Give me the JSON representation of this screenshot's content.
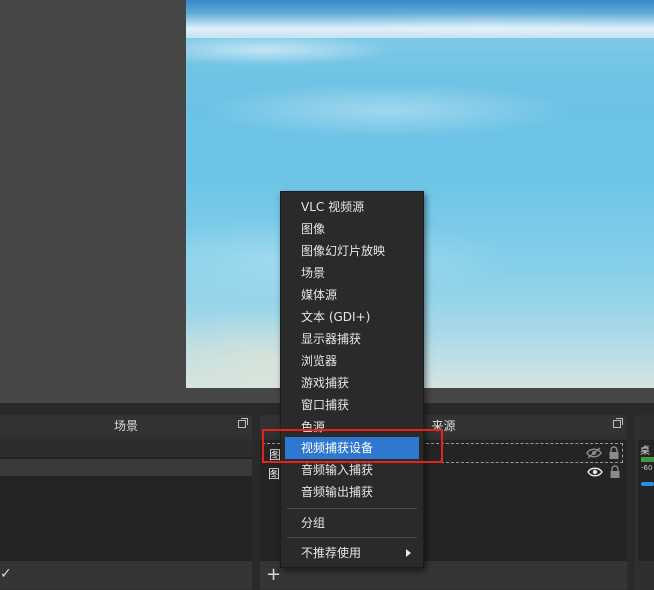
{
  "docks": {
    "scenes": {
      "title": "场景"
    },
    "sources": {
      "title": "来源",
      "items": [
        {
          "label": "图",
          "visible": false,
          "locked": true
        },
        {
          "label": "图",
          "visible": true,
          "locked": true
        }
      ]
    },
    "mixer": {
      "label": "桌",
      "db": "-60"
    }
  },
  "context_menu": {
    "items": [
      "VLC 视频源",
      "图像",
      "图像幻灯片放映",
      "场景",
      "媒体源",
      "文本 (GDI+)",
      "显示器捕获",
      "浏览器",
      "游戏捕获",
      "窗口捕获",
      "色源",
      "视频捕获设备",
      "音频输入捕获",
      "音频输出捕获"
    ],
    "highlighted": "视频捕获设备",
    "group_label": "分组",
    "deprecated_label": "不推荐使用"
  },
  "colors": {
    "highlight": "#2f78d2",
    "annotation_box": "#e3241b"
  }
}
